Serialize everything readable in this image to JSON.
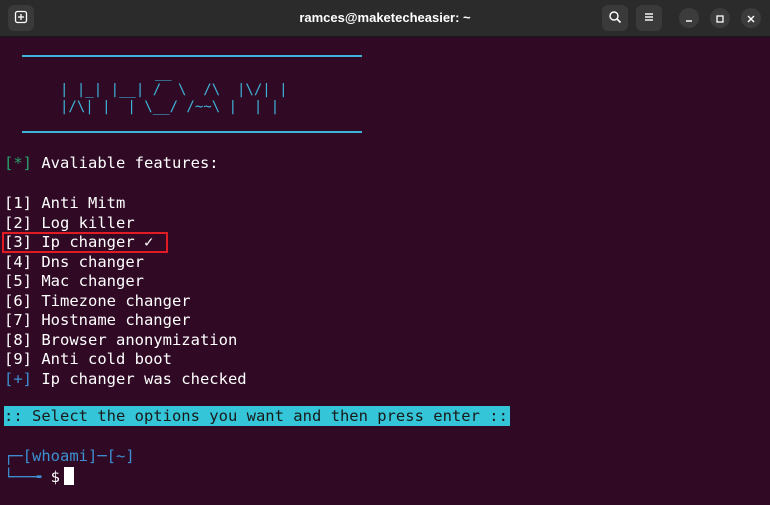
{
  "window": {
    "title": "ramces@maketecheasier: ~"
  },
  "icons": {
    "new_tab": "new-tab-icon",
    "search": "search-icon",
    "menu": "hamburger-menu-icon",
    "minimize": "minimize-icon",
    "maximize": "maximize-icon",
    "close": "close-icon"
  },
  "colors": {
    "background": "#300a24",
    "accent_cyan": "#3eb4da",
    "green": "#26a269",
    "blue": "#3d8fd1",
    "highlight_red": "#e01b24",
    "banner_bg": "#34c5d9"
  },
  "terminal": {
    "logo_line1": "  __      ",
    "logo_line2": "| |_| |__| /  \\  /\\  |\\/| |",
    "logo_line3": "|/\\| |  | \\__/ /~~\\ |  | |",
    "features_marker": "[*]",
    "features_title": " Avaliable features:",
    "items": [
      {
        "label": "[1] Anti Mitm"
      },
      {
        "label": "[2] Log killer"
      },
      {
        "label": "[3] Ip changer ✓"
      },
      {
        "label": "[4] Dns changer"
      },
      {
        "label": "[5] Mac changer"
      },
      {
        "label": "[6] Timezone changer"
      },
      {
        "label": "[7] Hostname changer"
      },
      {
        "label": "[8] Browser anonymization"
      },
      {
        "label": "[9] Anti cold boot"
      }
    ],
    "checked_marker": "[+]",
    "checked_text": " Ip changer was checked",
    "banner": ":: Select the options you want and then press enter ::",
    "prompt_line1": "┌─[whoami]─[~]",
    "prompt_line2_prefix": "└──╼",
    "prompt_symbol": " $"
  }
}
